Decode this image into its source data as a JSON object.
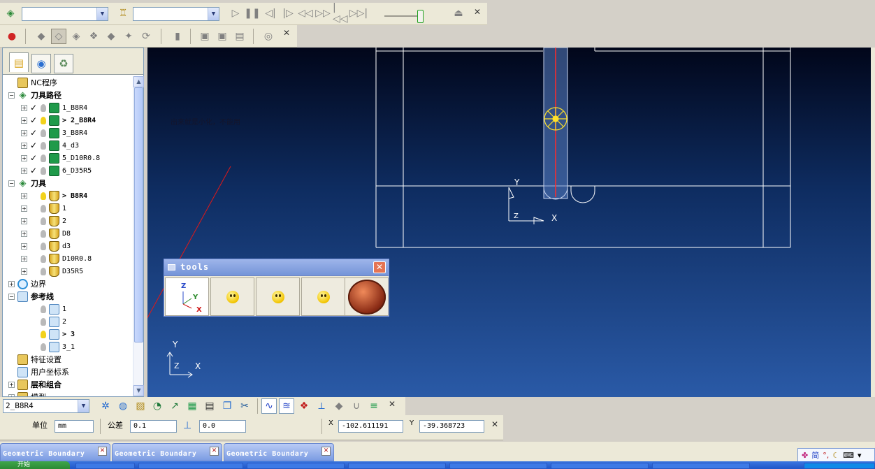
{
  "toolbar1": {
    "combo_a": "",
    "combo_b": ""
  },
  "tree": {
    "rows": [
      {
        "label": "NC程序",
        "indent": 0
      },
      {
        "label": "刀具路径",
        "bold": true
      },
      {
        "label": "1_B8R4"
      },
      {
        "label": "> 2_B8R4",
        "bold": true
      },
      {
        "label": "3_B8R4"
      },
      {
        "label": "4_d3"
      },
      {
        "label": "5_D10R0.8"
      },
      {
        "label": "6_D35R5"
      },
      {
        "label": "刀具",
        "bold": true
      },
      {
        "label": "> B8R4",
        "bold": true
      },
      {
        "label": "1"
      },
      {
        "label": "2"
      },
      {
        "label": "D8"
      },
      {
        "label": "d3"
      },
      {
        "label": "D10R0.8"
      },
      {
        "label": "D35R5"
      },
      {
        "label": "边界"
      },
      {
        "label": "参考线",
        "bold": true
      },
      {
        "label": "1"
      },
      {
        "label": "2"
      },
      {
        "label": "> 3",
        "bold": true
      },
      {
        "label": "3_1"
      },
      {
        "label": "特征设置"
      },
      {
        "label": "用户坐标系"
      },
      {
        "label": "层和组合",
        "bold": true
      },
      {
        "label": "模型"
      }
    ]
  },
  "viewport": {
    "note": "出来就是小化，不能用",
    "axis_labels": {
      "x": "X",
      "y": "Y",
      "z": "Z"
    }
  },
  "tools_window": {
    "title": "tools",
    "axis_btn": {
      "z": "Z",
      "y": "Y",
      "x": "X"
    }
  },
  "bottom_toolbar": {
    "toolpath_select": "2_B8R4"
  },
  "fields": {
    "unit_label": "单位",
    "unit_value": "mm",
    "tolerance_label": "公差",
    "tolerance_value": "0.1",
    "thickness_value": "0.0",
    "x_label": "X",
    "x_value": "-102.611191",
    "y_label": "Y",
    "y_value": "-39.368723"
  },
  "bottom_tabs": [
    {
      "label": "Geometric Boundary"
    },
    {
      "label": "Geometric Boundary"
    },
    {
      "label": "Geometric Boundary"
    }
  ],
  "taskbar": {
    "start": "开始"
  },
  "colors": {
    "toolpath_red": "#ff2a2a",
    "tool_yellow": "#ffe12a",
    "wire_white": "#ffffff",
    "annotation_red": "#e01818"
  }
}
